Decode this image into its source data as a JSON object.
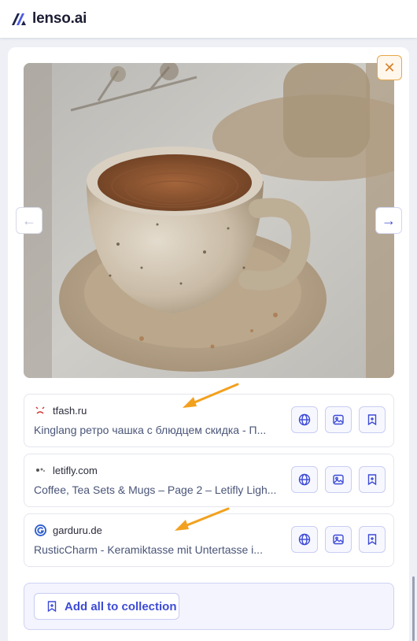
{
  "app": {
    "logo_text": "lenso.ai"
  },
  "viewer": {
    "close_label": "✕",
    "prev_label": "←",
    "next_label": "→"
  },
  "results": [
    {
      "domain": "tfash.ru",
      "title": "Kinglang ретро чашка с блюдцем скидка - П...",
      "favicon": "tfash-favicon-icon"
    },
    {
      "domain": "letifly.com",
      "title": "Coffee, Tea Sets & Mugs – Page 2 – Letifly Ligh...",
      "favicon": "letifly-favicon-icon"
    },
    {
      "domain": "garduru.de",
      "title": "RusticCharm - Keramiktasse mit Untertasse i...",
      "favicon": "garduru-favicon-icon"
    }
  ],
  "collection": {
    "add_all_label": "Add all to collection"
  },
  "colors": {
    "accent": "#3d4bd6",
    "close_orange": "#e8a64a",
    "annotation_arrow": "#f2a11e"
  }
}
